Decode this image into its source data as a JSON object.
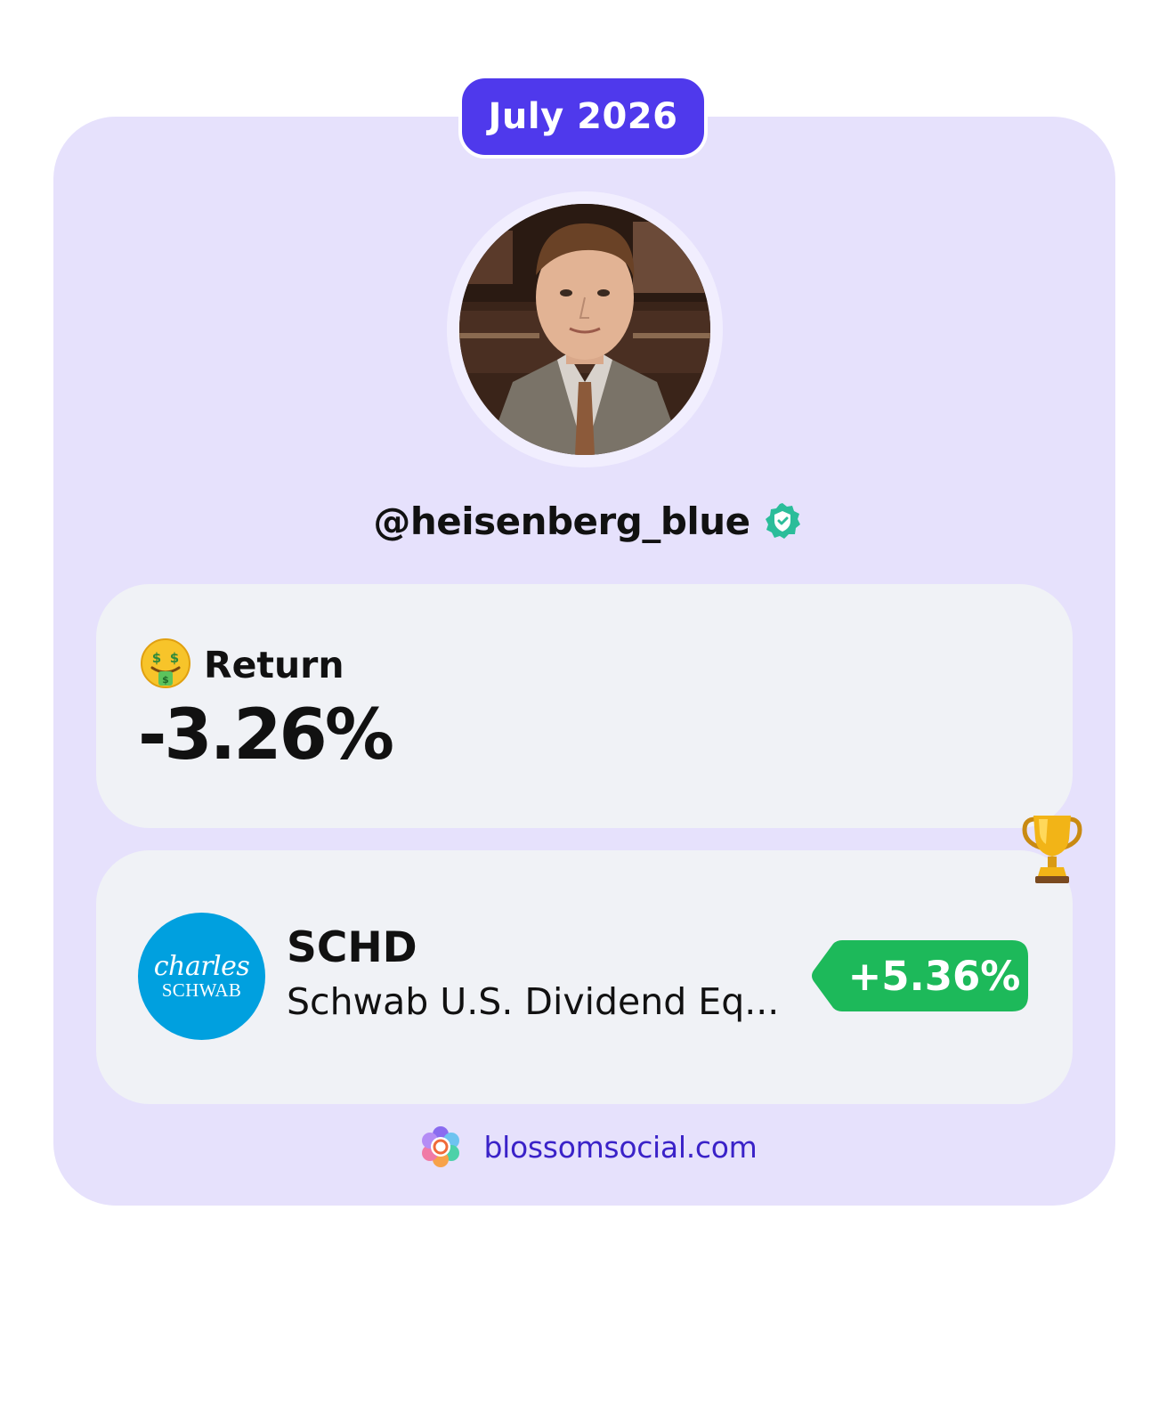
{
  "header": {
    "month_label": "July 2026"
  },
  "profile": {
    "username": "@heisenberg_blue",
    "verified_icon": "verified-badge-icon",
    "avatar": "profile-photo"
  },
  "return_card": {
    "emoji_icon": "money-mouth-face-icon",
    "label": "Return",
    "value": "-3.26%"
  },
  "top_holding": {
    "trophy_icon": "trophy-icon",
    "logo_line1": "charles",
    "logo_line2": "SCHWAB",
    "ticker": "SCHD",
    "name": "Schwab U.S. Dividend Eq...",
    "change": "+5.36%"
  },
  "footer": {
    "logo_icon": "blossom-logo-icon",
    "site": "blossomsocial.com"
  },
  "colors": {
    "card_background": "#e6e1fc",
    "month_pill": "#4f39ec",
    "panel_background": "#f0f2f6",
    "verified": "#2bbd9a",
    "gain_badge": "#1db95a",
    "schwab_blue": "#00a0df",
    "footer_text": "#3a22c8"
  }
}
